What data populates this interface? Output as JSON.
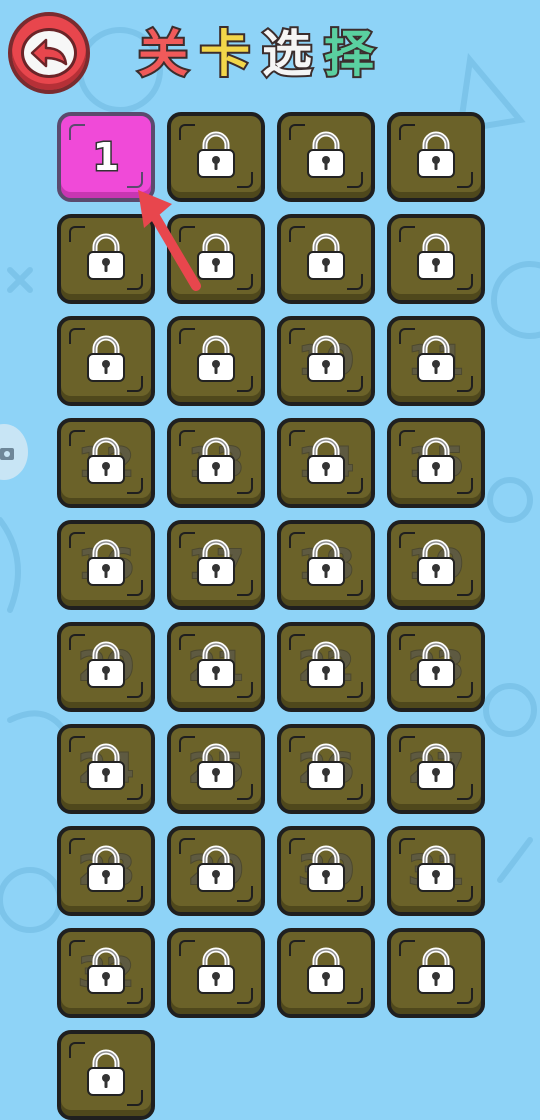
{
  "header": {
    "title_chars": [
      {
        "char": "关",
        "color": "#f05a5a"
      },
      {
        "char": "卡",
        "color": "#f2d64a"
      },
      {
        "char": "选",
        "color": "#f5f5f5"
      },
      {
        "char": "择",
        "color": "#5ad0a0"
      }
    ],
    "back_icon": "back-arrow-icon"
  },
  "levels": {
    "unlocked": [
      {
        "label": "1"
      }
    ],
    "locked_faint_numbers": [
      "",
      "",
      "",
      "",
      "",
      "",
      "",
      "",
      "",
      "10",
      "11",
      "12",
      "13",
      "14",
      "15",
      "16",
      "17",
      "18",
      "19",
      "20",
      "21",
      "22",
      "23",
      "24",
      "25",
      "26",
      "27",
      "28",
      "29",
      "30",
      "31",
      "32",
      "",
      "",
      "",
      ""
    ],
    "lock_icon": "padlock-icon"
  },
  "colors": {
    "background": "#8ed3f7",
    "locked_tile": "#6b6229",
    "unlocked_tile": "#f04ad8",
    "hint_arrow": "#e8464d"
  }
}
